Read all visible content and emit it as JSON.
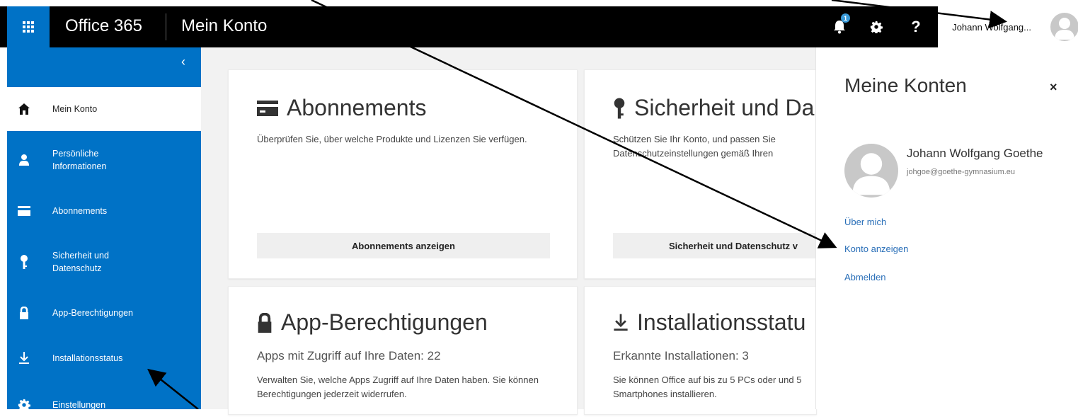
{
  "topbar": {
    "brand": "Office 365",
    "app_title": "Mein Konto",
    "notification_count": "1",
    "help_label": "?",
    "user_name": "Johann Wolfgang..."
  },
  "leftnav": {
    "collapse_label": "‹",
    "items": [
      {
        "label": "Mein Konto",
        "icon": "home-icon",
        "active": true
      },
      {
        "label": "Persönliche Informationen",
        "icon": "person-icon"
      },
      {
        "label": "Abonnements",
        "icon": "card-icon"
      },
      {
        "label": "Sicherheit und Datenschutz",
        "icon": "key-icon"
      },
      {
        "label": "App-Berechtigungen",
        "icon": "lock-icon"
      },
      {
        "label": "Installationsstatus",
        "icon": "download-icon"
      },
      {
        "label": "Einstellungen",
        "icon": "gear-icon"
      }
    ]
  },
  "cards": {
    "abonnements": {
      "title": "Abonnements",
      "description": "Überprüfen Sie, über welche Produkte und Lizenzen Sie verfügen.",
      "button": "Abonnements anzeigen"
    },
    "sicherheit": {
      "title": "Sicherheit und Da",
      "description": "Schützen Sie Ihr Konto, und passen Sie Datenschutzeinstellungen gemäß Ihren",
      "button": "Sicherheit und Datenschutz v"
    },
    "app_berechtigungen": {
      "title": "App-Berechtigungen",
      "subtitle": "Apps mit Zugriff auf Ihre Daten: 22",
      "description": "Verwalten Sie, welche Apps Zugriff auf Ihre Daten haben. Sie können Berechtigungen jederzeit widerrufen."
    },
    "installationsstatus": {
      "title": "Installationsstatu",
      "subtitle": "Erkannte Installationen: 3",
      "description": "Sie können Office auf bis zu 5 PCs oder und 5 Smartphones installieren."
    }
  },
  "panel": {
    "title": "Meine Konten",
    "close_label": "×",
    "name": "Johann Wolfgang Goethe",
    "email": "johgoe@goethe-gymnasium.eu",
    "links": [
      "Über mich",
      "Konto anzeigen",
      "Abmelden"
    ]
  },
  "colors": {
    "accent": "#0072c6",
    "topbar": "#000000",
    "link": "#2a6fb8"
  }
}
